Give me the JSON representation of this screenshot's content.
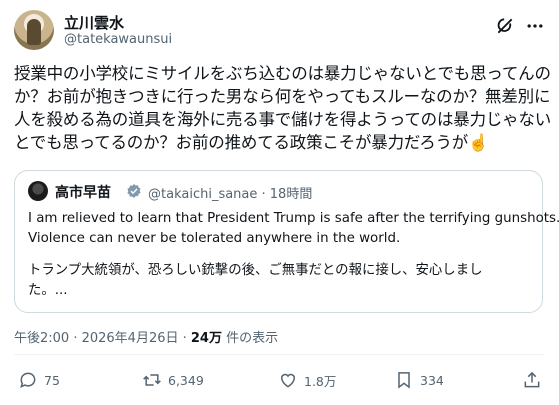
{
  "author": {
    "name": "立川雲水",
    "handle": "@tatekawaunsui"
  },
  "icons": {
    "grok": "grok-icon",
    "more": "more-icon"
  },
  "post": {
    "lines": [
      "授業中の小学校にミサイルをぶち込むのは暴力じゃないとでも思ってんの",
      "か？お前が抱きつきに行った男なら何をやってもスルーなのか？無差別に",
      "人を殺める為の道具を海外に売る事で儲けを得ようってのは暴力じゃない",
      "とでも思ってるのか？お前の推めてる政策こそが暴力だろうが☝️"
    ]
  },
  "quote": {
    "name": "高市早苗",
    "handle_time": "@takaichi_sanae · 18時間",
    "text_lines": [
      "I am relieved to learn that President Trump is safe after the terrifying gunshots.",
      "Violence can never be tolerated anywhere in the world.",
      "トランプ大統領が、恐ろしい銃撃の後、ご無事だとの報に接し、安心しまし",
      "た。..."
    ]
  },
  "meta": {
    "timestamp": "午後2:00 · 2026年4月26日 · ",
    "views": "24万",
    "views_suffix": " 件の表示"
  },
  "actions": {
    "replies": "75",
    "reposts": "6,349",
    "likes": "1.8万",
    "bookmarks": "334"
  }
}
